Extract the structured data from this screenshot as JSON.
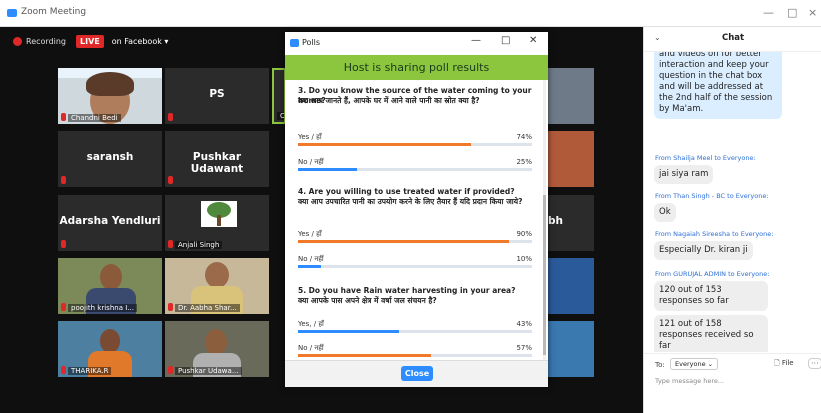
{
  "window": {
    "title": "Zoom Meeting",
    "controls": [
      "—",
      "□",
      "×"
    ]
  },
  "recording": {
    "label": "Recording",
    "live": "LIVE",
    "stream": "on Facebook ▾"
  },
  "tiles": [
    {
      "id": "t1",
      "caption": "Chandni Bedi",
      "label": ""
    },
    {
      "id": "t2",
      "caption": "",
      "label": "PS"
    },
    {
      "id": "t3",
      "caption": "Or",
      "label": ""
    },
    {
      "id": "t4",
      "caption": "",
      "label": "saransh"
    },
    {
      "id": "t5",
      "caption": "",
      "label": "Pushkar Udawant"
    },
    {
      "id": "t6",
      "caption": "",
      "label": "Adarsha Yendluri"
    },
    {
      "id": "t7",
      "caption": "Anjali Singh",
      "label": ""
    },
    {
      "id": "t8",
      "caption": "poojith krishna I...",
      "label": ""
    },
    {
      "id": "t9",
      "caption": "Dr. Aabha Shar...",
      "label": ""
    },
    {
      "id": "t10",
      "caption": "THARIKA.R",
      "label": ""
    },
    {
      "id": "t11",
      "caption": "Pushkar Udawa...",
      "label": ""
    },
    {
      "id": "t12",
      "caption": "",
      "label": "bh"
    }
  ],
  "poll": {
    "window_title": "Polls",
    "window_controls": [
      "—",
      "□",
      "✕"
    ],
    "banner": "Host is sharing poll results",
    "questions": [
      {
        "en": "3. Do you know the source of the water coming to your home?",
        "hi": "क्या आप जानते हैं, आपके घर में आने वाले पानी का स्रोत क्या है?",
        "options": [
          {
            "label": "Yes / हाँ",
            "pct": "74%",
            "value": 74,
            "color": "#f07a2a"
          },
          {
            "label": "No / नहीं",
            "pct": "25%",
            "value": 25,
            "color": "#2d8cff"
          }
        ]
      },
      {
        "en": "4. Are you willing to use treated water if provided?",
        "hi": "क्या आप उपचारित पानी का उपयोग करने के लिए तैयार हैं यदि प्रदान किया जाये?",
        "options": [
          {
            "label": "Yes / हाँ",
            "pct": "90%",
            "value": 90,
            "color": "#f07a2a"
          },
          {
            "label": "No / नहीं",
            "pct": "10%",
            "value": 10,
            "color": "#2d8cff"
          }
        ]
      },
      {
        "en": "5. Do you have Rain water harvesting in your area?",
        "hi": "क्या आपके पास अपने क्षेत्र में वर्षा जल संचयन है?",
        "options": [
          {
            "label": "Yes, / हाँ",
            "pct": "43%",
            "value": 43,
            "color": "#2d8cff"
          },
          {
            "label": "No / नहीं",
            "pct": "57%",
            "value": 57,
            "color": "#f07a2a"
          }
        ]
      }
    ],
    "close_label": "Close"
  },
  "chat": {
    "collapse": "⌄",
    "title": "Chat",
    "host_message": "keep your mics on mute and videos on for better interaction and keep your question in the chat box and will be addressed at the 2nd half of the session by Ma'am.",
    "messages": [
      {
        "from": "From Shailja Meel to Everyone:",
        "text": "jai siya ram"
      },
      {
        "from": "From Than Singh - BC to Everyone:",
        "text": "Ok"
      },
      {
        "from": "From Nagaiah Sireesha to Everyone:",
        "text": "Especially Dr. kiran ji"
      },
      {
        "from": "From GURUJAL ADMIN to Everyone:",
        "text": "120 out of 153 responses so far"
      },
      {
        "from": "",
        "text": "121 out of 158 responses received so far"
      }
    ],
    "to_label": "To:",
    "recipient": "Everyone ⌄",
    "file_label": "🗋 File",
    "more": "···",
    "placeholder": "Type message here..."
  }
}
